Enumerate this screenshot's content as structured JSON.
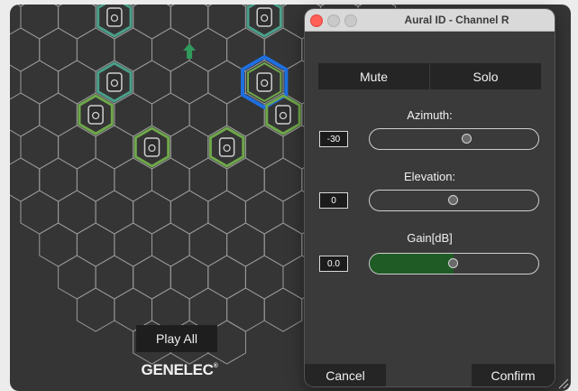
{
  "main": {
    "play_all_label": "Play All",
    "logo_text": "GENELEC",
    "logo_mark": "®"
  },
  "dialog": {
    "title": "Aural ID - Channel R",
    "mute_label": "Mute",
    "solo_label": "Solo",
    "cancel_label": "Cancel",
    "confirm_label": "Confirm",
    "controls": {
      "azimuth": {
        "label": "Azimuth:",
        "value": "-30",
        "level": 0.58
      },
      "elevation": {
        "label": "Elevation:",
        "value": "0",
        "level": 0.5
      },
      "gain": {
        "label": "Gain[dB]",
        "value": "0.0",
        "level": 0.5
      }
    }
  },
  "colors": {
    "hex_outline": "#9a9a9a",
    "speaker_ring": "#6fa84a",
    "speaker_ring_teal": "#4aa08a",
    "selected_ring": "#1e6fe0",
    "gain_fill": "#1f5b25",
    "arrow": "#2f9a5b"
  },
  "icons": {
    "speaker": "speaker-icon",
    "listener_arrow": "up-arrow-icon"
  }
}
